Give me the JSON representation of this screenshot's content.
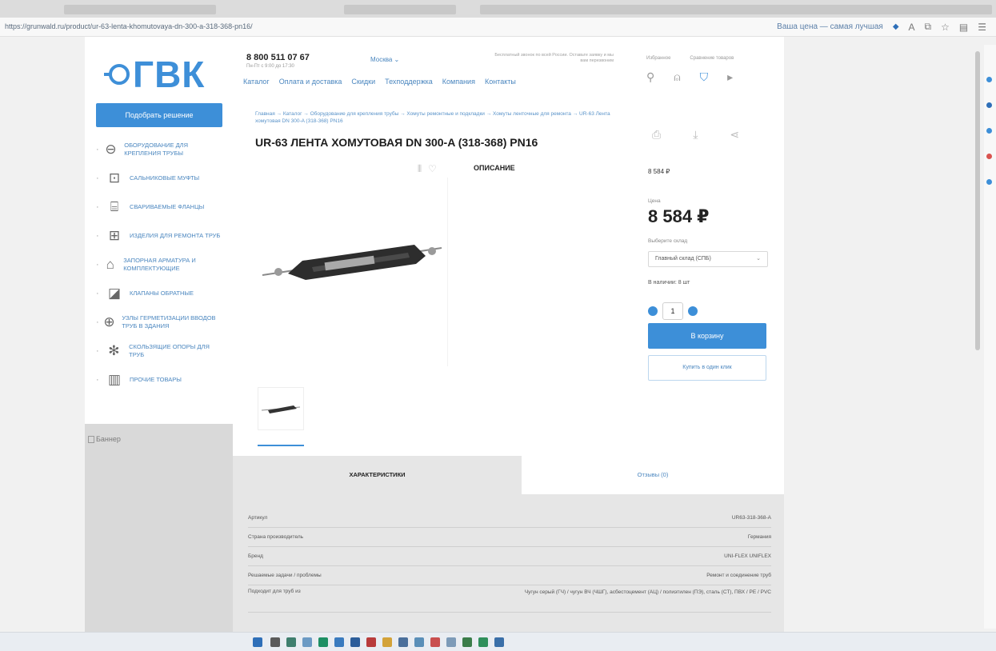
{
  "browser": {
    "url": "https://grunwald.ru/product/ur-63-lenta-khomutovaya-dn-300-a-318-368-pn16/",
    "promo": "Ваша цена — самая лучшая",
    "colors": {
      "pin": "#2e6fb8"
    }
  },
  "site": {
    "logo_text": "ГВК",
    "pick_button": "Подобрать решение",
    "phone": "8 800 511 07 67",
    "phone_sub": "Пн-Пт с 9:00 до 17:30",
    "city": "Москва",
    "header_note": "Бесплатный звонок по всей России. Оставьте заявку и мы вам перезвоним",
    "nav": [
      "Каталог",
      "Оплата и доставка",
      "Скидки",
      "Техподдержка",
      "Компания",
      "Контакты"
    ],
    "toolbar_labels": [
      "Избранное",
      "Сравнение товаров"
    ],
    "ad_text": "Баннер"
  },
  "categories": [
    {
      "icon": "clamp-icon",
      "label": "Оборудование для крепления трубы"
    },
    {
      "icon": "frame-icon",
      "label": "Сальниковые муфты"
    },
    {
      "icon": "flange-icon",
      "label": "Свариваемые фланцы"
    },
    {
      "icon": "repair-icon",
      "label": "Изделия для ремонта труб"
    },
    {
      "icon": "valve-icon",
      "label": "Запорная арматура и комплектующие"
    },
    {
      "icon": "gate-icon",
      "label": "Клапаны обратные"
    },
    {
      "icon": "seal-icon",
      "label": "Узлы герметизации вводов труб в здания"
    },
    {
      "icon": "support-icon",
      "label": "Скользящие опоры для труб"
    },
    {
      "icon": "misc-icon",
      "label": "Прочие товары"
    }
  ],
  "product": {
    "breadcrumbs": "Главная → Каталог → Оборудование для крепления трубы → Хомуты ремонтные и подкладки → Хомуты ленточные для ремонта → UR-63 Лента хомутовая DN 300-A (318-368) PN16",
    "title": "UR-63 ЛЕНТА ХОМУТОВАЯ DN 300-A (318-368) PN16",
    "description_tab": "ОПИСАНИЕ",
    "price_small": "8 584 ₽",
    "price_label": "Цена",
    "price": "8 584 ₽",
    "warehouse_label": "Выберите склад",
    "warehouse": "Главный склад (СПБ)",
    "stock": "В наличии: 8 шт",
    "quantity": "1",
    "cart_button": "В корзину",
    "oneclick_button": "Купить в один клик"
  },
  "tabs": {
    "characteristics": "ХАРАКТЕРИСТИКИ",
    "reviews": "Отзывы (0)"
  },
  "specs": [
    {
      "name": "Артикул",
      "value": "UR63-318-368-A"
    },
    {
      "name": "Страна производитель",
      "value": "Германия"
    },
    {
      "name": "Бренд",
      "value": "UNI-FLEX UNIFLEX"
    },
    {
      "name": "Решаемые задачи / проблемы",
      "value": "Ремонт и соединение труб"
    },
    {
      "name": "Подходит для труб из",
      "value": "Чугун серый (ГЧ) / чугун ВЧ (ЧШГ), асбестоцемент (АЦ) / полиэтилен (ПЭ), сталь (СТ), ПВХ / PE / PVC"
    }
  ],
  "colors": {
    "accent": "#3d8fd8",
    "link": "#4a86bf"
  }
}
